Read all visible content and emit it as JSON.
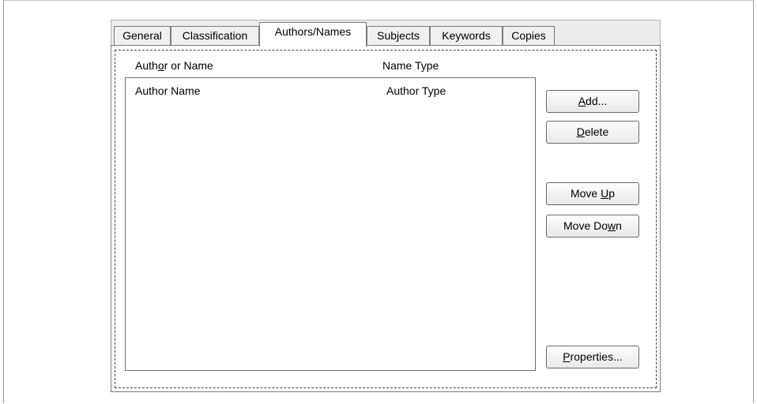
{
  "tabs": [
    {
      "label": "General",
      "active": false
    },
    {
      "label": "Classification",
      "active": false
    },
    {
      "label": "Authors/Names",
      "active": true
    },
    {
      "label": "Subjects",
      "active": false
    },
    {
      "label": "Keywords",
      "active": false
    },
    {
      "label": "Copies",
      "active": false
    }
  ],
  "columns": {
    "author_header_pre": "Auth",
    "author_header_key": "o",
    "author_header_post": "r or Name",
    "type_header": "Name Type"
  },
  "list": {
    "rows": [
      {
        "name": "Author Name",
        "type": "Author Type"
      }
    ]
  },
  "buttons": {
    "add": {
      "key": "A",
      "rest": "dd..."
    },
    "delete": {
      "key": "D",
      "rest": "elete"
    },
    "move_up": {
      "pre": "Move ",
      "key": "U",
      "rest": "p"
    },
    "move_down": {
      "pre": "Move Do",
      "key": "w",
      "rest": "n"
    },
    "properties": {
      "key": "P",
      "rest": "roperties..."
    }
  }
}
